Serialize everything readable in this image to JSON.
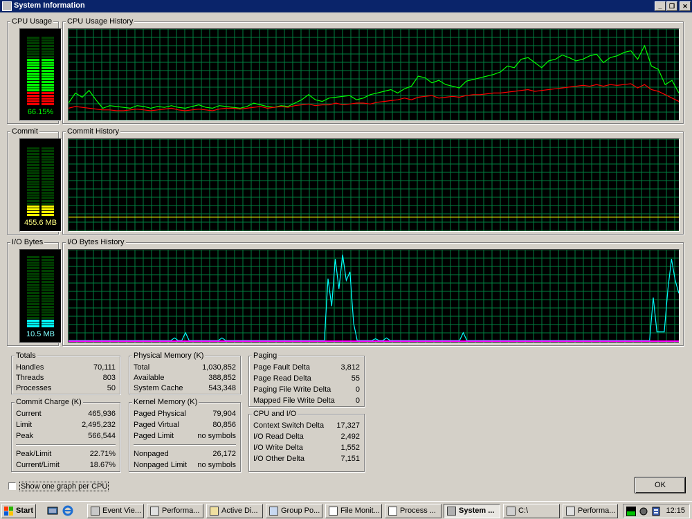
{
  "window": {
    "title": "System Information",
    "icon": "sysinfo-app-icon",
    "minimize": "minimize-icon",
    "maximize": "restore-icon",
    "close": "close-icon"
  },
  "colors": {
    "cpu_total": "#00ff00",
    "cpu_kernel": "#ff0000",
    "commit": "#ffff00",
    "io": "#00ffff",
    "grid": "#008040"
  },
  "cpu": {
    "meter_title": "CPU Usage",
    "history_title": "CPU Usage History",
    "value_text": "66.15%",
    "usage": 0.6615,
    "kernel": 0.2,
    "history_total": [
      18,
      30,
      25,
      33,
      22,
      12,
      15,
      14,
      13,
      12,
      15,
      14,
      12,
      14,
      13,
      15,
      13,
      12,
      14,
      16,
      13,
      12,
      15,
      14,
      13,
      12,
      14,
      18,
      16,
      14,
      13,
      15,
      14,
      18,
      22,
      28,
      22,
      20,
      24,
      25,
      26,
      27,
      22,
      24,
      28,
      30,
      32,
      34,
      30,
      35,
      38,
      50,
      48,
      42,
      45,
      40,
      38,
      36,
      44,
      46,
      48,
      50,
      52,
      55,
      62,
      60,
      70,
      72,
      66,
      60,
      68,
      70,
      75,
      72,
      68,
      70,
      74,
      76,
      66,
      72,
      74,
      78,
      80,
      70,
      86,
      62,
      58,
      40,
      45,
      30
    ],
    "history_kernel": [
      12,
      14,
      13,
      12,
      11,
      10,
      10,
      9,
      9,
      10,
      11,
      10,
      9,
      10,
      11,
      12,
      10,
      9,
      10,
      11,
      10,
      9,
      11,
      12,
      12,
      11,
      12,
      13,
      14,
      12,
      13,
      14,
      13,
      15,
      16,
      17,
      15,
      16,
      16,
      18,
      16,
      17,
      18,
      18,
      17,
      19,
      20,
      21,
      22,
      24,
      22,
      25,
      26,
      27,
      24,
      25,
      26,
      25,
      27,
      28,
      28,
      29,
      30,
      30,
      31,
      32,
      33,
      34,
      32,
      33,
      34,
      35,
      36,
      37,
      38,
      39,
      38,
      40,
      38,
      40,
      39,
      40,
      41,
      36,
      40,
      34,
      32,
      28,
      24,
      20
    ]
  },
  "commit": {
    "meter_title": "Commit",
    "history_title": "Commit History",
    "value_text": "455.6 MB",
    "usage": 0.15,
    "history": [
      14,
      14,
      14,
      14,
      14,
      14,
      14,
      14,
      14,
      14,
      14,
      14,
      14,
      14,
      14,
      14,
      14,
      14,
      14,
      14,
      14,
      14,
      14,
      14,
      14,
      14,
      14,
      14,
      14,
      14,
      14,
      14,
      14,
      14,
      14,
      14,
      14,
      14,
      14,
      14,
      14,
      14,
      14,
      14,
      14,
      14,
      14,
      14,
      14,
      14,
      14,
      14,
      14,
      14,
      14,
      14,
      14,
      14,
      14,
      14,
      14,
      14,
      14,
      14,
      14,
      14,
      14,
      14,
      14,
      14,
      14,
      14,
      14,
      14,
      14,
      14,
      14,
      14,
      14,
      14,
      14,
      14,
      14,
      14,
      14,
      14,
      14,
      14,
      14,
      14
    ]
  },
  "io": {
    "meter_title": "I/O Bytes",
    "history_title": "I/O Bytes History",
    "value_text": "10.5 MB",
    "usage": 0.12,
    "history": [
      0,
      0,
      0,
      0,
      0,
      0,
      0,
      0,
      0,
      0,
      0,
      0,
      0,
      0,
      0,
      0,
      0,
      0,
      0,
      0,
      0,
      0,
      0,
      0,
      0,
      0,
      0,
      0,
      0,
      3,
      0,
      0,
      9,
      0,
      0,
      0,
      0,
      0,
      0,
      0,
      0,
      0,
      3,
      0,
      0,
      0,
      0,
      0,
      0,
      0,
      0,
      0,
      0,
      0,
      0,
      0,
      0,
      0,
      0,
      0,
      0,
      0,
      0,
      0,
      0,
      0,
      0,
      0,
      0,
      0,
      0,
      72,
      40,
      95,
      60,
      100,
      70,
      80,
      20,
      0,
      0,
      0,
      0,
      0,
      2,
      0,
      0,
      3,
      0,
      0,
      0,
      0,
      0,
      0,
      0,
      0,
      0,
      0,
      0,
      0,
      0,
      0,
      0,
      0,
      0,
      0,
      0,
      0,
      9,
      0,
      0,
      0,
      0,
      0,
      0,
      0,
      0,
      0,
      0,
      0,
      0,
      0,
      0,
      0,
      0,
      0,
      0,
      0,
      0,
      0,
      0,
      0,
      0,
      0,
      0,
      0,
      0,
      0,
      0,
      0,
      0,
      0,
      0,
      0,
      0,
      0,
      0,
      0,
      0,
      0,
      0,
      0,
      0,
      0,
      0,
      0,
      0,
      0,
      0,
      0,
      50,
      10,
      10,
      10,
      60,
      95,
      70,
      55
    ]
  },
  "totals": {
    "title": "Totals",
    "rows": [
      {
        "label": "Handles",
        "value": "70,111"
      },
      {
        "label": "Threads",
        "value": "803"
      },
      {
        "label": "Processes",
        "value": "50"
      }
    ]
  },
  "physical": {
    "title": "Physical Memory (K)",
    "rows": [
      {
        "label": "Total",
        "value": "1,030,852"
      },
      {
        "label": "Available",
        "value": "388,852"
      },
      {
        "label": "System Cache",
        "value": "543,348"
      }
    ]
  },
  "paging": {
    "title": "Paging",
    "rows": [
      {
        "label": "Page Fault Delta",
        "value": "3,812"
      },
      {
        "label": "Page Read Delta",
        "value": "55"
      },
      {
        "label": "Paging File Write Delta",
        "value": "0"
      },
      {
        "label": "Mapped File Write Delta",
        "value": "0"
      }
    ]
  },
  "commit_charge": {
    "title": "Commit Charge (K)",
    "rows": [
      {
        "label": "Current",
        "value": "465,936"
      },
      {
        "label": "Limit",
        "value": "2,495,232"
      },
      {
        "label": "Peak",
        "value": "566,544"
      }
    ],
    "rows2": [
      {
        "label": "Peak/Limit",
        "value": "22.71%"
      },
      {
        "label": "Current/Limit",
        "value": "18.67%"
      }
    ]
  },
  "kernel": {
    "title": "Kernel Memory (K)",
    "rows": [
      {
        "label": "Paged Physical",
        "value": "79,904"
      },
      {
        "label": "Paged Virtual",
        "value": "80,856"
      },
      {
        "label": "Paged Limit",
        "value": "no symbols"
      }
    ],
    "rows2": [
      {
        "label": "Nonpaged",
        "value": "26,172"
      },
      {
        "label": "Nonpaged Limit",
        "value": "no symbols"
      }
    ]
  },
  "cpuio": {
    "title": "CPU and I/O",
    "rows": [
      {
        "label": "Context Switch Delta",
        "value": "17,327"
      },
      {
        "label": "I/O Read Delta",
        "value": "2,492"
      },
      {
        "label": "I/O Write Delta",
        "value": "1,552"
      },
      {
        "label": "I/O Other Delta",
        "value": "7,151"
      }
    ]
  },
  "checkbox": {
    "label": "Show one graph per CPU",
    "checked": false
  },
  "ok_label": "OK",
  "taskbar": {
    "start_label": "Start",
    "tasks": [
      "Event Vie...",
      "Performa...",
      "Active Di...",
      "Group Po...",
      "File Monit...",
      "Process ...",
      "System ...",
      "C:\\",
      "Performa..."
    ],
    "task_icons": [
      "event-viewer-icon",
      "performance-icon",
      "active-directory-icon",
      "group-policy-icon",
      "file-monitor-icon",
      "process-explorer-icon",
      "system-info-icon",
      "drive-icon",
      "performance-icon"
    ],
    "active_index": 6,
    "clock": "12:15"
  }
}
